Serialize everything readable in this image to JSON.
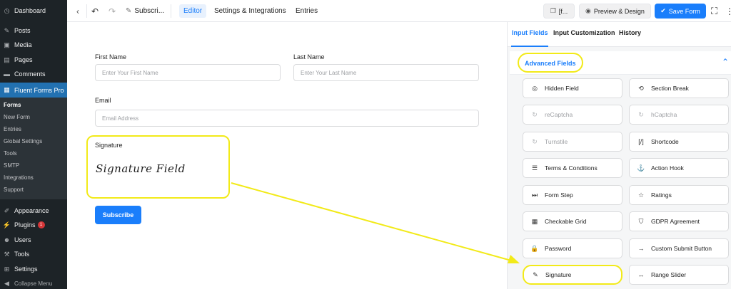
{
  "wp_menu": {
    "dashboard": "Dashboard",
    "posts": "Posts",
    "media": "Media",
    "pages": "Pages",
    "comments": "Comments",
    "fluent_forms": "Fluent Forms Pro",
    "submenu": [
      "Forms",
      "New Form",
      "Entries",
      "Global Settings",
      "Tools",
      "SMTP",
      "Integrations",
      "Support"
    ],
    "appearance": "Appearance",
    "plugins": "Plugins",
    "plugins_badge": "1",
    "users": "Users",
    "tools": "Tools",
    "settings": "Settings",
    "collapse": "Collapse Menu"
  },
  "toolbar": {
    "form_title": "Subscri...",
    "tabs": [
      "Editor",
      "Settings & Integrations",
      "Entries"
    ],
    "shortcode_label": "[f...",
    "preview_label": "Preview & Design",
    "save_label": "Save Form"
  },
  "form": {
    "first_name_label": "First Name",
    "first_name_placeholder": "Enter Your First Name",
    "last_name_label": "Last Name",
    "last_name_placeholder": "Enter Your Last Name",
    "email_label": "Email",
    "email_placeholder": "Email Address",
    "signature_label": "Signature",
    "signature_field_text": "Signature Field",
    "submit_label": "Subscribe"
  },
  "panel": {
    "tabs": [
      "Input Fields",
      "Input Customization",
      "History"
    ],
    "section_title": "Advanced Fields",
    "fields": [
      {
        "label": "Hidden Field",
        "icon": "eye-slash-icon",
        "enabled": true
      },
      {
        "label": "Section Break",
        "icon": "section-break-icon",
        "enabled": true
      },
      {
        "label": "reCaptcha",
        "icon": "recaptcha-icon",
        "enabled": false
      },
      {
        "label": "hCaptcha",
        "icon": "hcaptcha-icon",
        "enabled": false
      },
      {
        "label": "Turnstile",
        "icon": "turnstile-icon",
        "enabled": false
      },
      {
        "label": "Shortcode",
        "icon": "shortcode-icon",
        "enabled": true
      },
      {
        "label": "Terms & Conditions",
        "icon": "terms-icon",
        "enabled": true
      },
      {
        "label": "Action Hook",
        "icon": "hook-icon",
        "enabled": true
      },
      {
        "label": "Form Step",
        "icon": "form-step-icon",
        "enabled": true
      },
      {
        "label": "Ratings",
        "icon": "star-icon",
        "enabled": true
      },
      {
        "label": "Checkable Grid",
        "icon": "grid-icon",
        "enabled": true
      },
      {
        "label": "GDPR Agreement",
        "icon": "shield-icon",
        "enabled": true
      },
      {
        "label": "Password",
        "icon": "lock-icon",
        "enabled": true
      },
      {
        "label": "Custom Submit Button",
        "icon": "arrow-right-icon",
        "enabled": true
      },
      {
        "label": "Signature",
        "icon": "pen-icon",
        "enabled": true
      },
      {
        "label": "Range Slider",
        "icon": "range-slider-icon",
        "enabled": true
      }
    ]
  },
  "colors": {
    "accent": "#1a7efb",
    "highlight": "#f2ea18",
    "wp_sidebar": "#1d2327",
    "wp_active": "#2271b1"
  }
}
